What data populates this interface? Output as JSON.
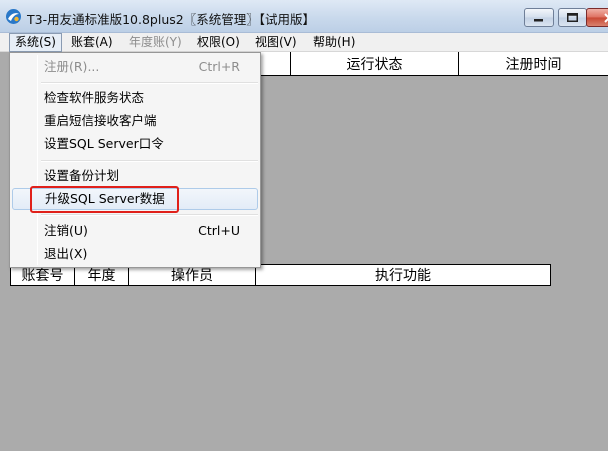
{
  "window": {
    "title": "T3-用友通标准版10.8plus2〖系统管理〗【试用版】"
  },
  "menubar": {
    "items": [
      {
        "label": "系统(S)"
      },
      {
        "label": "账套(A)"
      },
      {
        "label": "年度账(Y)"
      },
      {
        "label": "权限(O)"
      },
      {
        "label": "视图(V)"
      },
      {
        "label": "帮助(H)"
      }
    ]
  },
  "system_menu": {
    "register": {
      "label": "注册(R)...",
      "shortcut": "Ctrl+R"
    },
    "check_service": {
      "label": "检查软件服务状态"
    },
    "restart_sms": {
      "label": "重启短信接收客户端"
    },
    "set_sql_password": {
      "label": "设置SQL Server口令"
    },
    "backup_plan": {
      "label": "设置备份计划"
    },
    "upgrade_sql": {
      "label": "升级SQL Server数据"
    },
    "logout": {
      "label": "注销(U)",
      "shortcut": "Ctrl+U"
    },
    "exit": {
      "label": "退出(X)"
    }
  },
  "top_table": {
    "columns": [
      "",
      "运行状态",
      "注册时间"
    ]
  },
  "bottom_table": {
    "columns": [
      "账套号",
      "年度",
      "操作员",
      "执行功能"
    ]
  },
  "colors": {
    "highlight_border": "#e0201a",
    "workspace_bg": "#ababab"
  },
  "icons": {
    "app": "app-logo-icon",
    "minimize": "minimize-icon",
    "maximize": "maximize-icon",
    "close": "close-icon"
  }
}
